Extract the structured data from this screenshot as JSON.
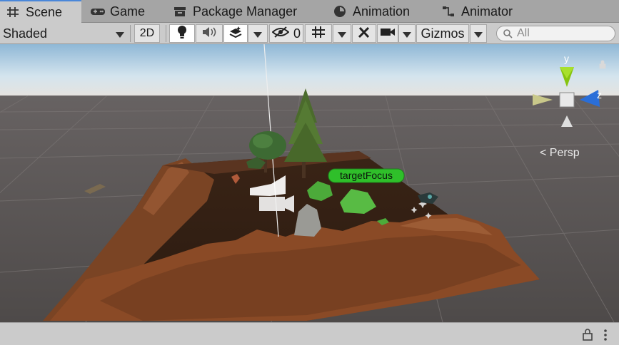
{
  "tabs": [
    {
      "label": "Scene",
      "icon": "grid-icon"
    },
    {
      "label": "Game",
      "icon": "gamepad-icon"
    },
    {
      "label": "Package Manager",
      "icon": "package-icon"
    },
    {
      "label": "Animation",
      "icon": "animation-clock-icon"
    },
    {
      "label": "Animator",
      "icon": "animator-icon"
    }
  ],
  "toolbar": {
    "draw_mode": "Shaded",
    "mode_2d": "2D",
    "hidden_count": "0",
    "gizmos": "Gizmos",
    "search_placeholder": "All"
  },
  "scene": {
    "target_label": "targetFocus",
    "projection": "Persp",
    "axes": {
      "y": "y",
      "z": "z"
    }
  },
  "colors": {
    "accent": "#4a87d9",
    "sky": "#bcd6ea",
    "ground": "#5c5755",
    "terrain": "#7a4024",
    "label_bg": "#2fbf2a"
  }
}
